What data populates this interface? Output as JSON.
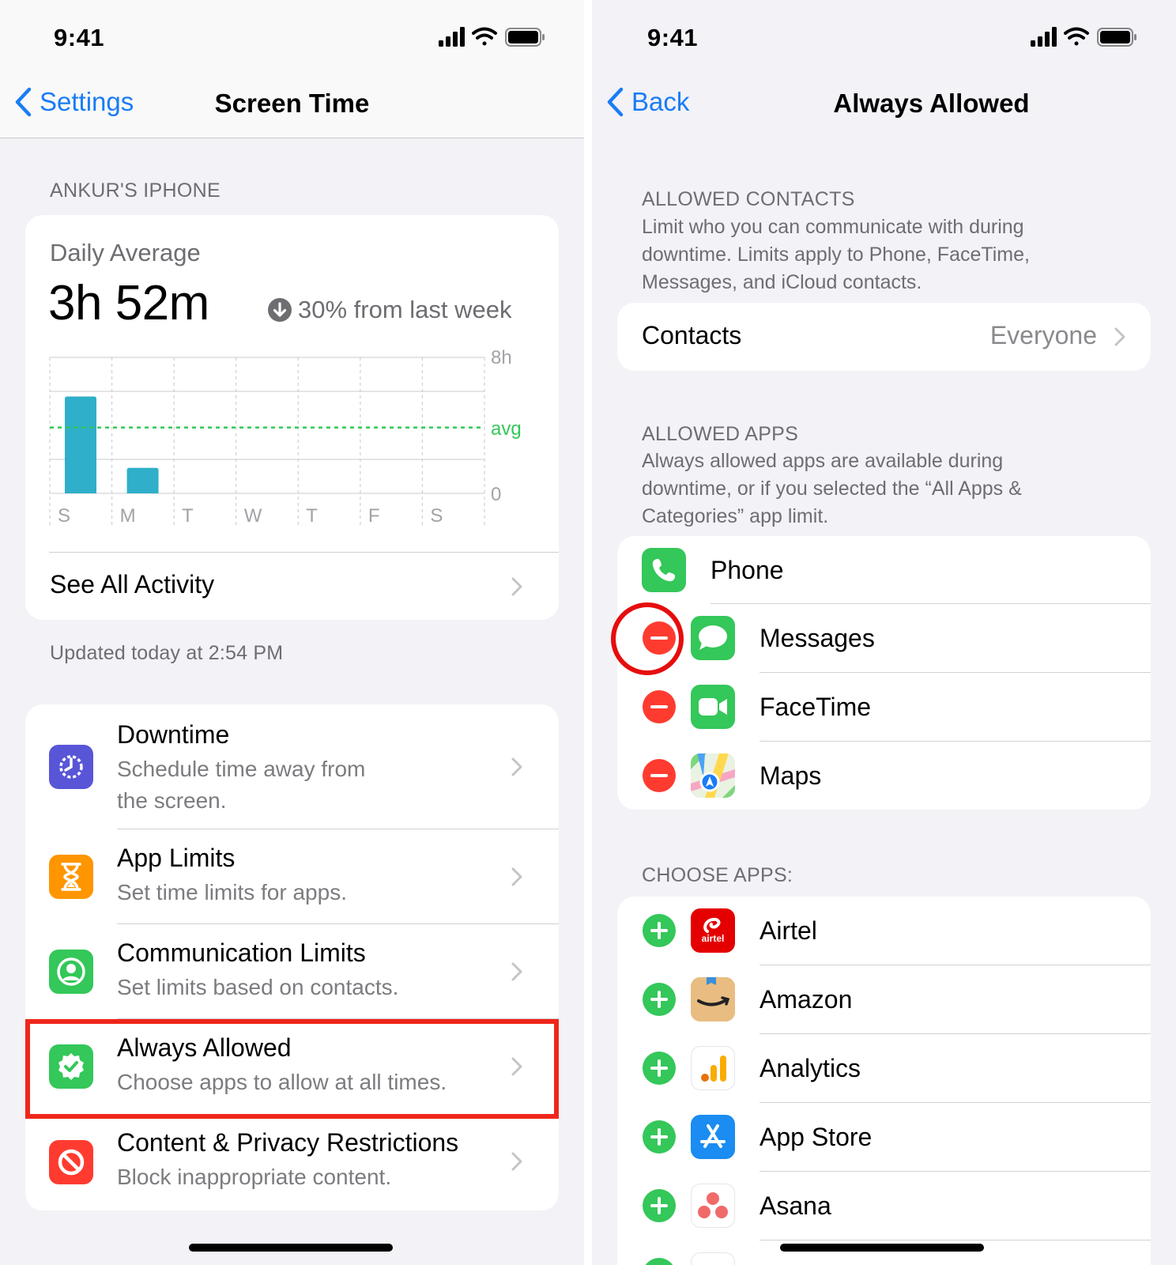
{
  "left": {
    "status": {
      "time": "9:41"
    },
    "nav": {
      "back_label": "Settings",
      "title": "Screen Time"
    },
    "device_label": "ANKUR'S IPHONE",
    "summary": {
      "daily_average_label": "Daily Average",
      "daily_average_value": "3h 52m",
      "change_text": "30% from last week",
      "change_direction": "down",
      "see_all_label": "See All Activity",
      "updated_text": "Updated today at 2:54 PM"
    },
    "chart_data": {
      "type": "bar",
      "categories": [
        "S",
        "M",
        "T",
        "W",
        "T",
        "F",
        "S"
      ],
      "values": [
        5.7,
        1.5,
        0,
        0,
        0,
        0,
        0
      ],
      "y_max_label": "8h",
      "y_min_label": "0",
      "avg_label": "avg",
      "avg_value": 3.87,
      "ylim": [
        0,
        8
      ],
      "bar_color": "#2fafc9",
      "avg_color": "#34c759"
    },
    "menu": [
      {
        "title": "Downtime",
        "subtitle": "Schedule time away from the screen.",
        "icon": "downtime-icon",
        "color": "#5856d6"
      },
      {
        "title": "App Limits",
        "subtitle": "Set time limits for apps.",
        "icon": "hourglass-icon",
        "color": "#ff9500"
      },
      {
        "title": "Communication Limits",
        "subtitle": "Set limits based on contacts.",
        "icon": "contact-icon",
        "color": "#34c759"
      },
      {
        "title": "Always Allowed",
        "subtitle": "Choose apps to allow at all times.",
        "icon": "checkmark-seal-icon",
        "color": "#34c759"
      },
      {
        "title": "Content & Privacy Restrictions",
        "subtitle": "Block inappropriate content.",
        "icon": "restriction-icon",
        "color": "#ff3b30"
      }
    ]
  },
  "right": {
    "status": {
      "time": "9:41"
    },
    "nav": {
      "back_label": "Back",
      "title": "Always Allowed"
    },
    "contacts_section": {
      "header": "ALLOWED CONTACTS",
      "description": "Limit who you can communicate with during downtime. Limits apply to Phone, FaceTime, Messages, and iCloud contacts.",
      "row_label": "Contacts",
      "row_value": "Everyone"
    },
    "apps_section": {
      "header": "ALLOWED APPS",
      "description": "Always allowed apps are available during downtime, or if you selected the “All Apps & Categories” app limit.",
      "apps": [
        {
          "name": "Phone",
          "icon": "phone-app-icon",
          "removable": false
        },
        {
          "name": "Messages",
          "icon": "messages-app-icon",
          "removable": true
        },
        {
          "name": "FaceTime",
          "icon": "facetime-app-icon",
          "removable": true
        },
        {
          "name": "Maps",
          "icon": "maps-app-icon",
          "removable": true
        }
      ]
    },
    "choose_section": {
      "header": "CHOOSE APPS:",
      "apps": [
        {
          "name": "Airtel",
          "icon": "airtel-app-icon",
          "icon_text": "airtel"
        },
        {
          "name": "Amazon",
          "icon": "amazon-app-icon"
        },
        {
          "name": "Analytics",
          "icon": "analytics-app-icon"
        },
        {
          "name": "App Store",
          "icon": "app-store-icon"
        },
        {
          "name": "Asana",
          "icon": "asana-app-icon"
        }
      ]
    },
    "colors": {
      "accent": "#1a7cf5",
      "remove": "#ff3b30",
      "add": "#34c759",
      "highlight": "#f0261a"
    }
  }
}
